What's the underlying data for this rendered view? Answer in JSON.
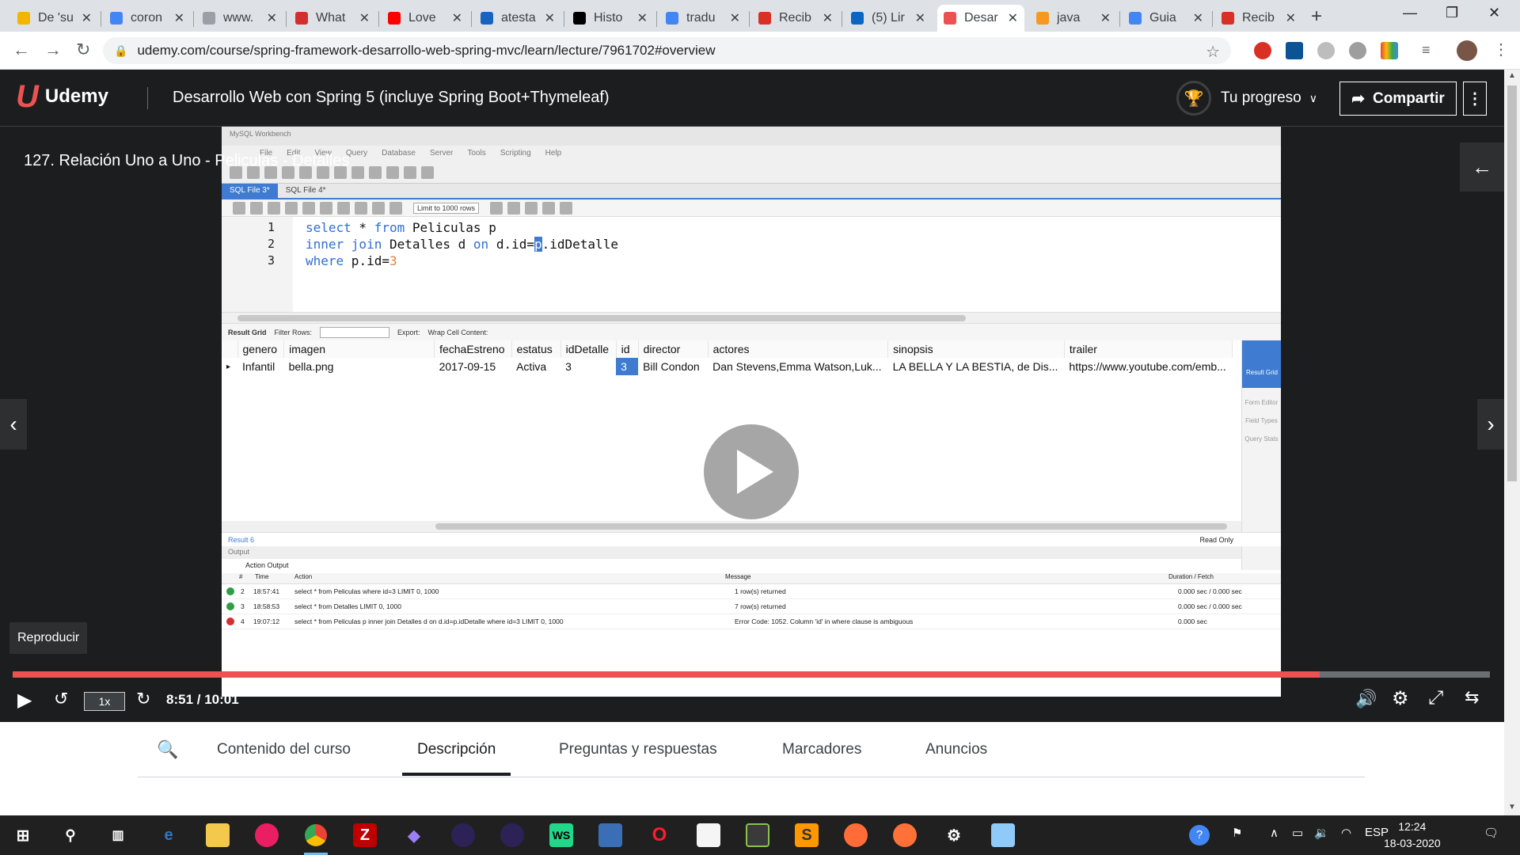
{
  "browser": {
    "tabs": [
      {
        "title": "De 'su",
        "color": "#f4b400"
      },
      {
        "title": "coron",
        "color": "#4285f4"
      },
      {
        "title": "www.",
        "color": "#9aa0a6"
      },
      {
        "title": "What",
        "color": "#d32f2f"
      },
      {
        "title": "Love",
        "color": "#ff0000"
      },
      {
        "title": "atesta",
        "color": "#1565c0"
      },
      {
        "title": "Histo",
        "color": "#000000"
      },
      {
        "title": "tradu",
        "color": "#4285f4"
      },
      {
        "title": "Recib",
        "color": "#d93025"
      },
      {
        "title": "(5) Lir",
        "color": "#0a66c2"
      },
      {
        "title": "Desar",
        "color": "#ec5252"
      },
      {
        "title": "java",
        "color": "#f89820"
      },
      {
        "title": "Guia",
        "color": "#4285f4"
      },
      {
        "title": "Recib",
        "color": "#d93025"
      }
    ],
    "active_tab_index": 10,
    "url": "udemy.com/course/spring-framework-desarrollo-web-spring-mvc/learn/lecture/7961702#overview"
  },
  "header": {
    "logo_text": "Udemy",
    "course_title": "Desarrollo Web con Spring 5 (incluye Spring Boot+Thymeleaf)",
    "progress_label": "Tu progreso",
    "share_label": "Compartir"
  },
  "video": {
    "lecture_title": "127. Relación Uno a Uno - Peliculas - Detalles",
    "play_tooltip": "Reproducir",
    "playback_rate": "1x",
    "timecode": "8:51 / 10:01",
    "progress_fraction": 0.885
  },
  "workbench": {
    "window_title": "MySQL Workbench",
    "menu": [
      "File",
      "Edit",
      "View",
      "Query",
      "Database",
      "Server",
      "Tools",
      "Scripting",
      "Help"
    ],
    "tabs": [
      "SQL File 3*",
      "SQL File 4*"
    ],
    "limit_label": "Limit to 1000 rows",
    "sql_lines": [
      {
        "num": "1",
        "text": "select * from Peliculas p"
      },
      {
        "num": "2",
        "text": "inner join Detalles d on d.id=p.idDetalle"
      },
      {
        "num": "3",
        "text": "where p.id=3"
      }
    ],
    "result_bar": {
      "result_grid": "Result Grid",
      "filter": "Filter Rows:",
      "export": "Export:",
      "wrap": "Wrap Cell Content:"
    },
    "columns": [
      "genero",
      "imagen",
      "fechaEstreno",
      "estatus",
      "idDetalle",
      "id",
      "director",
      "actores",
      "sinopsis",
      "trailer"
    ],
    "row": [
      "Infantil",
      "bella.png",
      "2017-09-15",
      "Activa",
      "3",
      "3",
      "Bill Condon",
      "Dan Stevens,Emma Watson,Luk...",
      "LA BELLA Y LA BESTIA, de Dis...",
      "https://www.youtube.com/emb..."
    ],
    "side_panels": [
      "Result Grid",
      "Form Editor",
      "Field Types",
      "Query Stats"
    ],
    "result_tab": "Result 6",
    "read_only": "Read Only",
    "output_label": "Output",
    "action_output": "Action Output",
    "output_cols": [
      "#",
      "Time",
      "Action",
      "Message",
      "Duration / Fetch"
    ],
    "output_rows": [
      {
        "n": "2",
        "time": "18:57:41",
        "action": "select * from Peliculas where id=3 LIMIT 0, 1000",
        "msg": "1 row(s) returned",
        "dur": "0.000 sec / 0.000 sec",
        "status": "ok"
      },
      {
        "n": "3",
        "time": "18:58:53",
        "action": "select * from Detalles LIMIT 0, 1000",
        "msg": "7 row(s) returned",
        "dur": "0.000 sec / 0.000 sec",
        "status": "ok"
      },
      {
        "n": "4",
        "time": "19:07:12",
        "action": "select * from Peliculas p inner join Detalles d on d.id=p.idDetalle where id=3 LIMIT 0, 1000",
        "msg": "Error Code: 1052. Column 'id' in where clause is ambiguous",
        "dur": "0.000 sec",
        "status": "error"
      }
    ]
  },
  "course_nav": {
    "items": [
      "Contenido del curso",
      "Descripción",
      "Preguntas y respuestas",
      "Marcadores",
      "Anuncios"
    ],
    "active_index": 1
  },
  "system": {
    "language": "ESP",
    "time": "12:24",
    "date": "18-03-2020"
  }
}
